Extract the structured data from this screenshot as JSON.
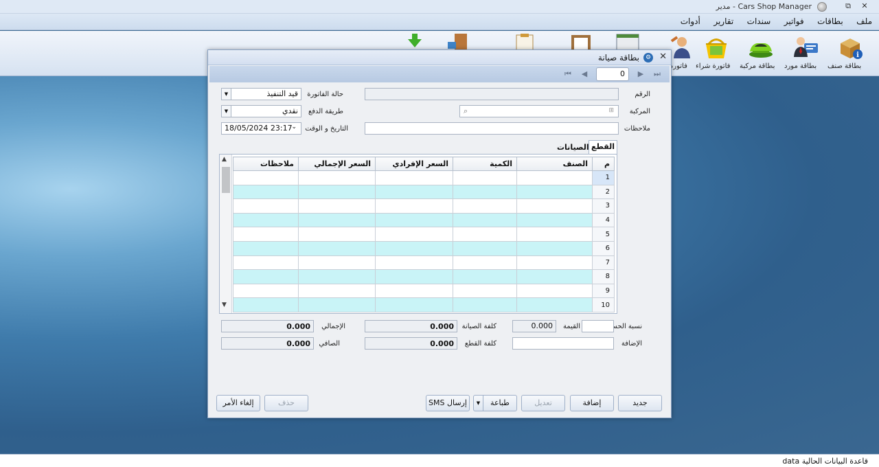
{
  "window": {
    "title": "Cars Shop Manager - مدير"
  },
  "menu": [
    "ملف",
    "بطاقات",
    "فواتير",
    "سندات",
    "تقارير",
    "أدوات"
  ],
  "ribbon": {
    "items": [
      {
        "label": "بطاقة صنف",
        "icon": "box-info-icon"
      },
      {
        "label": "بطاقة مورد",
        "icon": "supplier-card-icon"
      },
      {
        "label": "بطاقة مركبة",
        "icon": "car-icon"
      },
      {
        "label": "فاتورة شراء",
        "icon": "shopping-basket-icon"
      },
      {
        "label": "فاتورة",
        "icon": "mechanic-icon"
      }
    ]
  },
  "dialog": {
    "title": "بطاقة صيانة",
    "page_number": "0",
    "labels": {
      "number": "الرقم",
      "vehicle": "المركبة",
      "notes": "ملاحظات",
      "invoice_status": "حالة الفاتورة",
      "payment_method": "طريقة الدفع",
      "datetime": "التاريخ و الوقت",
      "discount_pct": "نسبة الحسم",
      "value": "القيمة",
      "addition": "الإضافة",
      "maintenance_cost": "كلفة الصيانة",
      "parts_cost": "كلفة القطع",
      "total": "الإجمالي",
      "net": "الصافي"
    },
    "fields": {
      "number": "",
      "vehicle": "",
      "notes": "",
      "invoice_status": "قيد التنفيذ",
      "payment_method": "نقدي",
      "datetime": "18/05/2024 23:17",
      "discount_pct": "",
      "value": "0.000",
      "addition": "",
      "maintenance_cost": "0.000",
      "parts_cost": "0.000",
      "total": "0.000",
      "net": "0.000"
    },
    "tabs": [
      "القطع",
      "الصيانات"
    ],
    "grid": {
      "columns": [
        "م",
        "الصنف",
        "الكمية",
        "السعر الإفرادي",
        "السعر الإجمالي",
        "ملاحظات"
      ],
      "rows": [
        "1",
        "2",
        "3",
        "4",
        "5",
        "6",
        "7",
        "8",
        "9",
        "10"
      ]
    },
    "buttons": {
      "new": "جديد",
      "add": "إضافة",
      "edit": "تعديل",
      "print": "طباعة",
      "sms": "إرسال SMS",
      "delete": "حذف",
      "cancel": "إلغاء الأمر"
    }
  },
  "status": {
    "text": "قاعدة البيانات الحالية data"
  }
}
